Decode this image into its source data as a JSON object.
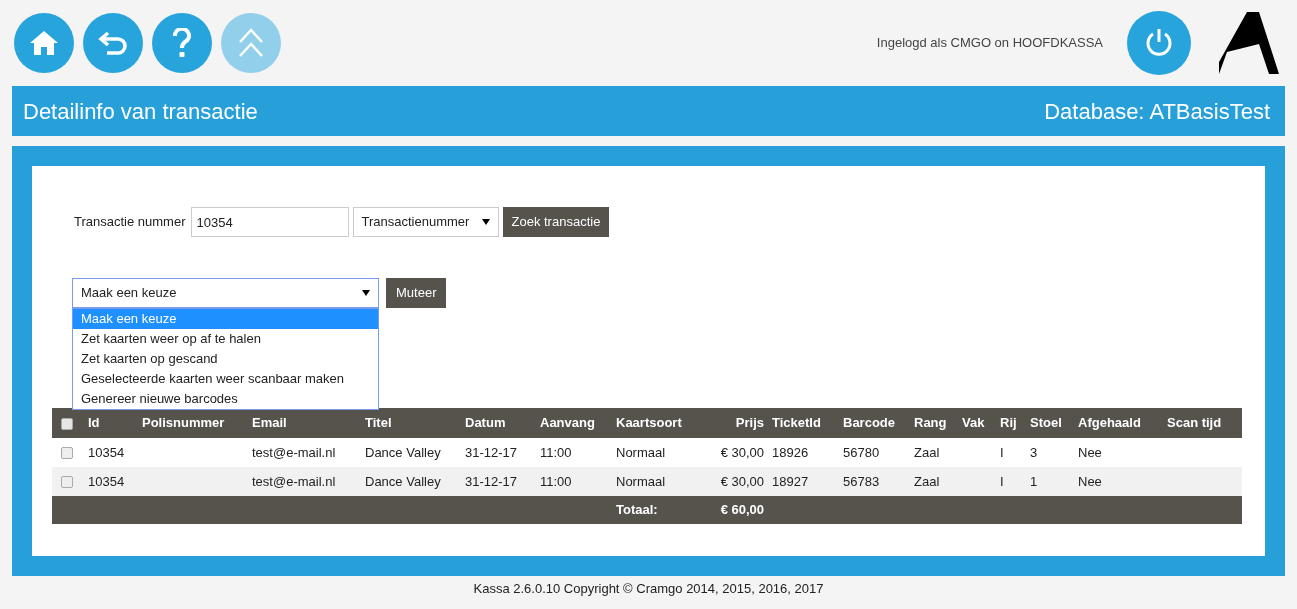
{
  "nav_buttons": [
    {
      "kind": "home",
      "disabled": false
    },
    {
      "kind": "back",
      "disabled": false
    },
    {
      "kind": "help",
      "disabled": false
    },
    {
      "kind": "up",
      "disabled": true
    }
  ],
  "login_text": "Ingelogd als CMGO on HOOFDKASSA",
  "header": {
    "title": "Detailinfo van transactie",
    "database": "Database: ATBasisTest"
  },
  "search": {
    "label": "Transactie nummer",
    "value": "10354",
    "type_select": "Transactienummer",
    "button": "Zoek transactie"
  },
  "mutate": {
    "select_value": "Maak een keuze",
    "expanded": true,
    "button": "Muteer",
    "options": [
      {
        "label": "Maak een keuze",
        "selected": true
      },
      {
        "label": "Zet kaarten weer op af te halen",
        "selected": false
      },
      {
        "label": "Zet kaarten op gescand",
        "selected": false
      },
      {
        "label": "Geselecteerde kaarten weer scanbaar maken",
        "selected": false
      },
      {
        "label": "Genereer nieuwe barcodes",
        "selected": false
      }
    ]
  },
  "table": {
    "select_all_checked": false,
    "columns": [
      "Id",
      "Polisnummer",
      "Email",
      "Titel",
      "Datum",
      "Aanvang",
      "Kaartsoort",
      "Prijs",
      "TicketId",
      "Barcode",
      "Rang",
      "Vak",
      "Rij",
      "Stoel",
      "Afgehaald",
      "Scan tijd"
    ],
    "rows": [
      {
        "checked": false,
        "cells": [
          "10354",
          "",
          "test@e-mail.nl",
          "Dance Valley",
          "31-12-17",
          "11:00",
          "Normaal",
          "€ 30,00",
          "18926",
          "56780",
          "Zaal",
          "",
          "I",
          "3",
          "Nee",
          ""
        ]
      },
      {
        "checked": false,
        "cells": [
          "10354",
          "",
          "test@e-mail.nl",
          "Dance Valley",
          "31-12-17",
          "11:00",
          "Normaal",
          "€ 30,00",
          "18927",
          "56783",
          "Zaal",
          "",
          "I",
          "1",
          "Nee",
          ""
        ]
      }
    ],
    "total": {
      "label": "Totaal:",
      "amount": "€ 60,00"
    }
  },
  "footer": "Kassa 2.6.0.10 Copyright © Cramgo 2014, 2015, 2016, 2017"
}
